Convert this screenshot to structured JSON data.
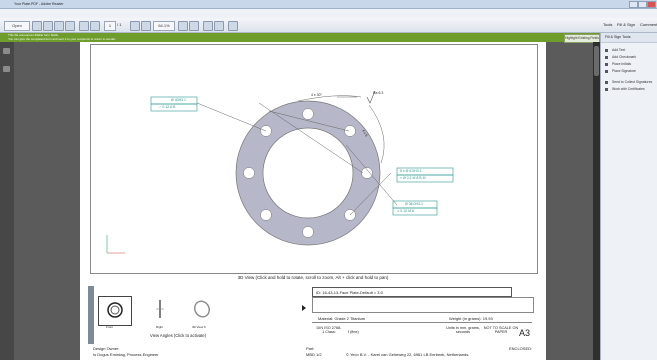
{
  "window": {
    "title": "Your Plate.PDF - Adobe Reader"
  },
  "menu": [
    "File",
    "Edit",
    "View",
    "Window",
    "Help"
  ],
  "toolbar": {
    "open_label": "Open",
    "page_current": "1",
    "page_total": "/ 1",
    "zoom": "64.1%"
  },
  "panel_buttons": [
    "Tools",
    "Fill & Sign",
    "Comment"
  ],
  "message": {
    "line1": "This file announces fillable form fields.",
    "line2": "You can give the completed form and sent it to your recipients to return to sender.",
    "highlight_button": "Highlight Existing Fields"
  },
  "right_panel": {
    "header": "Fill & Sign Tools",
    "items": [
      "Add Text",
      "Add Checkmark",
      "Place Initials",
      "Place Signature",
      "Send to Collect Signatures",
      "Work with Certificates"
    ]
  },
  "drawing": {
    "view_caption": "3D View (Click and hold to rotate, scroll to zoom, Alt + click and hold to pan)",
    "dims": {
      "d1": "Ø 40H3.1",
      "d1b": "⟋ 0.12  A  B",
      "d2": "4 x 30°",
      "d3": "Ra 6.3",
      "d4": "4 x 6",
      "d5": "8 x Ø 6.0H3.1",
      "d5b": "⌖ Ø 0.2 M  A  B M",
      "d6": "Ø 38.0H3.1",
      "d6b": "⟂ 0.10 M  A"
    }
  },
  "title_block": {
    "id": "ID: 16-43-13-Face Plate-Default = 3.0",
    "material": "Material:  Grade 2 Titanium",
    "weight": "Weight (in grams):  19.93",
    "din": "DIN ISO 2768-1 Class:",
    "din_class": "f (fine)",
    "units": "Units in mm, grams, seconds",
    "scale": "NOT TO SCALE ON PAPER",
    "format": "A3",
    "view_angles": "View Angles (Click to activate)",
    "thumb_labels": [
      "Front",
      "Right",
      "3D View 6"
    ],
    "design_owner_label": "Design Owner:",
    "design_owner": "Is Dogus Emirdag, Process Engineer",
    "part_label": "Part:",
    "part": "MBD 1/2",
    "company": "© Yeco B.V. - Karel van Gelreweg 22, 6961 LB Eerbeek, Netherlands.",
    "enclosed": "ENCLOSED:"
  },
  "colors": {
    "accent_green": "#6e9d2c",
    "part_fill": "#b6b7c8",
    "dim_teal": "#2a9a8f"
  }
}
